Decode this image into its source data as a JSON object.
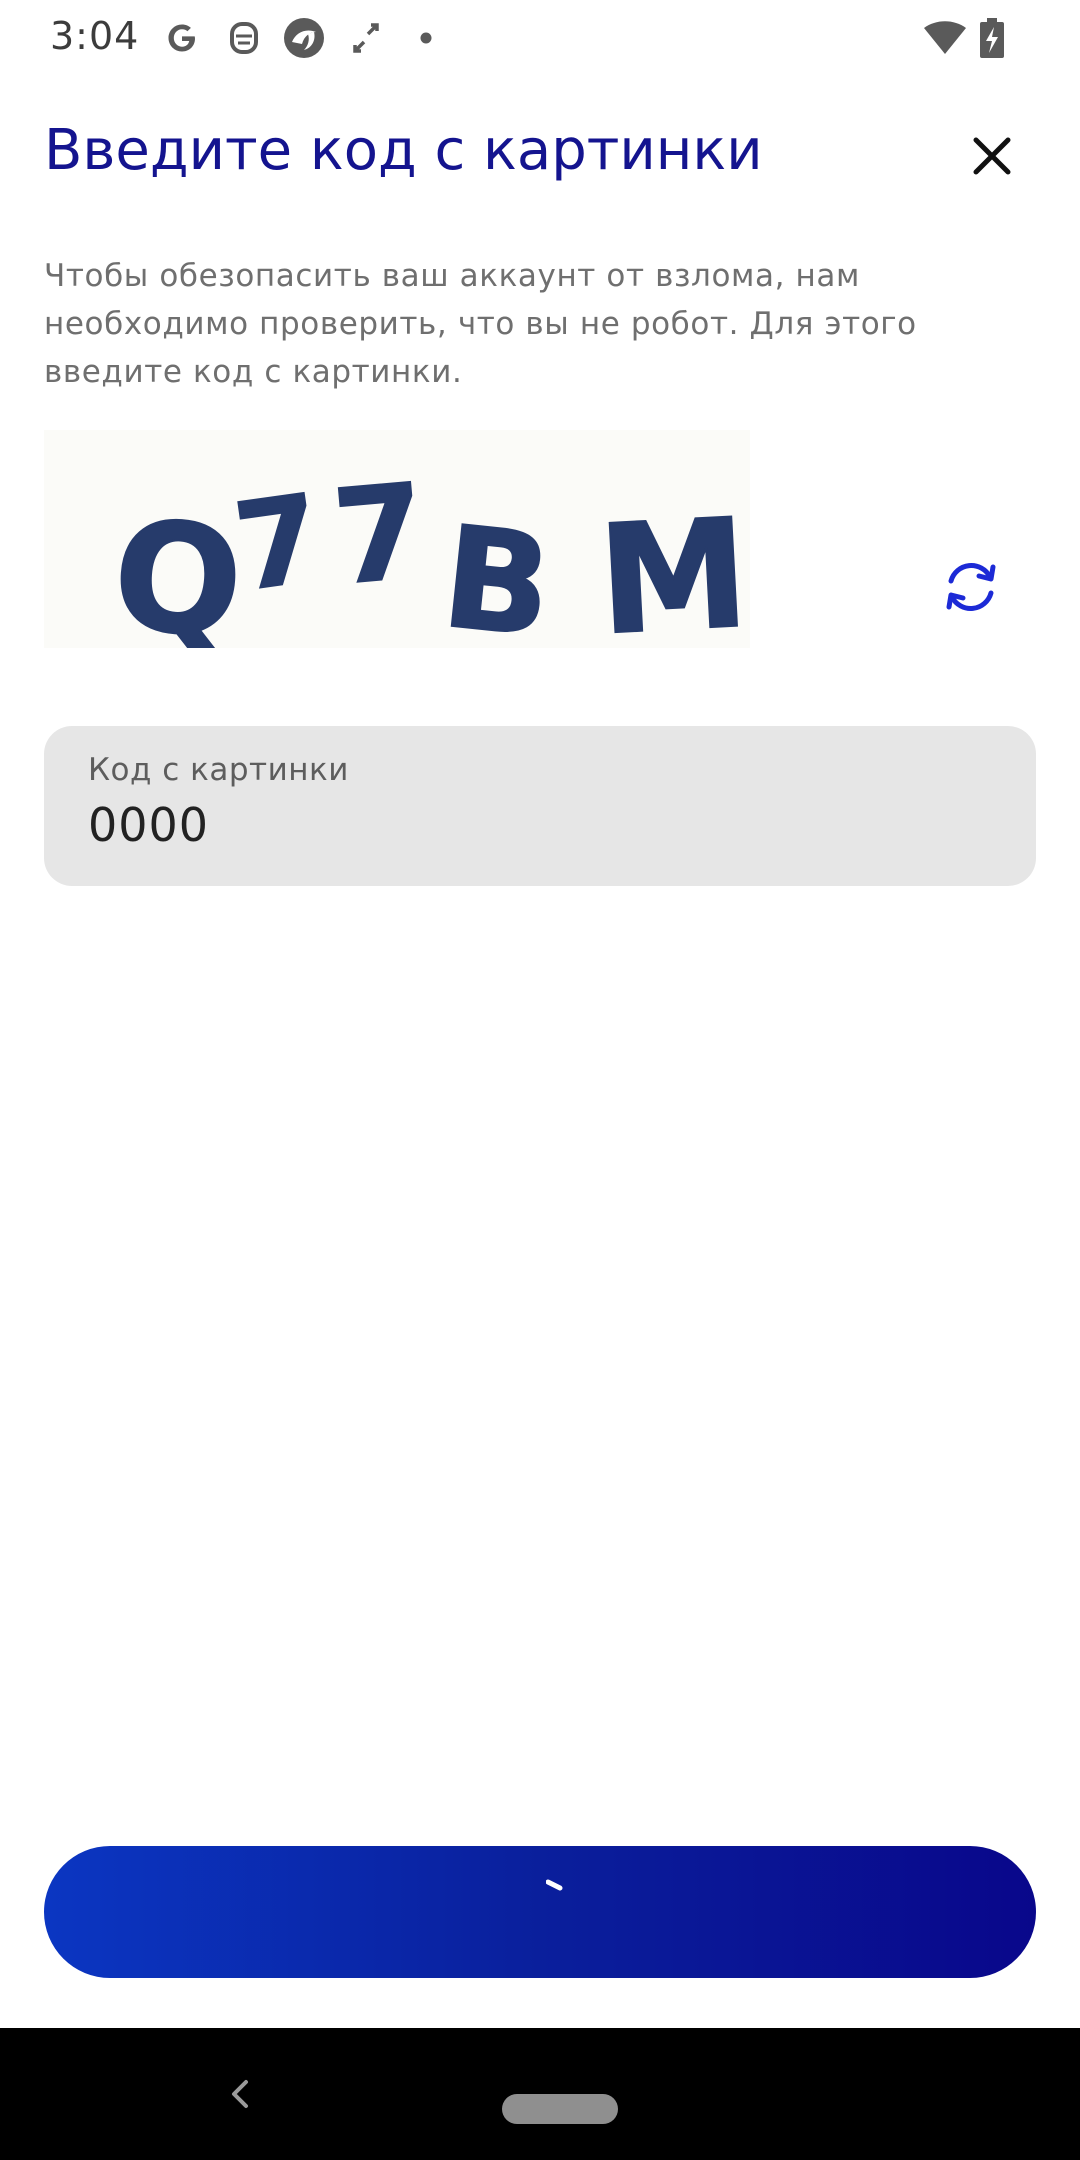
{
  "status_bar": {
    "time": "3:04",
    "icons": [
      "google-icon",
      "robot-icon",
      "circle-app-icon",
      "expand-icon",
      "dot-icon",
      "wifi-icon",
      "battery-charging-icon"
    ]
  },
  "header": {
    "title": "Введите код с картинки",
    "close_icon": "close-icon"
  },
  "description": "Чтобы обезопасить ваш аккаунт от взлома, нам необходимо проверить, что вы не робот. Для этого введите код с картинки.",
  "captcha": {
    "text": "Q77BM",
    "refresh_icon": "refresh-icon",
    "accent_color": "#1c2ad6"
  },
  "code_field": {
    "label": "Код с картинки",
    "value": "0000"
  },
  "submit_button": {
    "state": "loading",
    "gradient": [
      "#0b36c2",
      "#09078b"
    ]
  },
  "nav_bar": {
    "back_icon": "back-icon",
    "home_icon": "home-pill-icon"
  },
  "colors": {
    "title": "#14148f",
    "text": "#6f6f6f",
    "field_bg": "#e6e6e6"
  }
}
